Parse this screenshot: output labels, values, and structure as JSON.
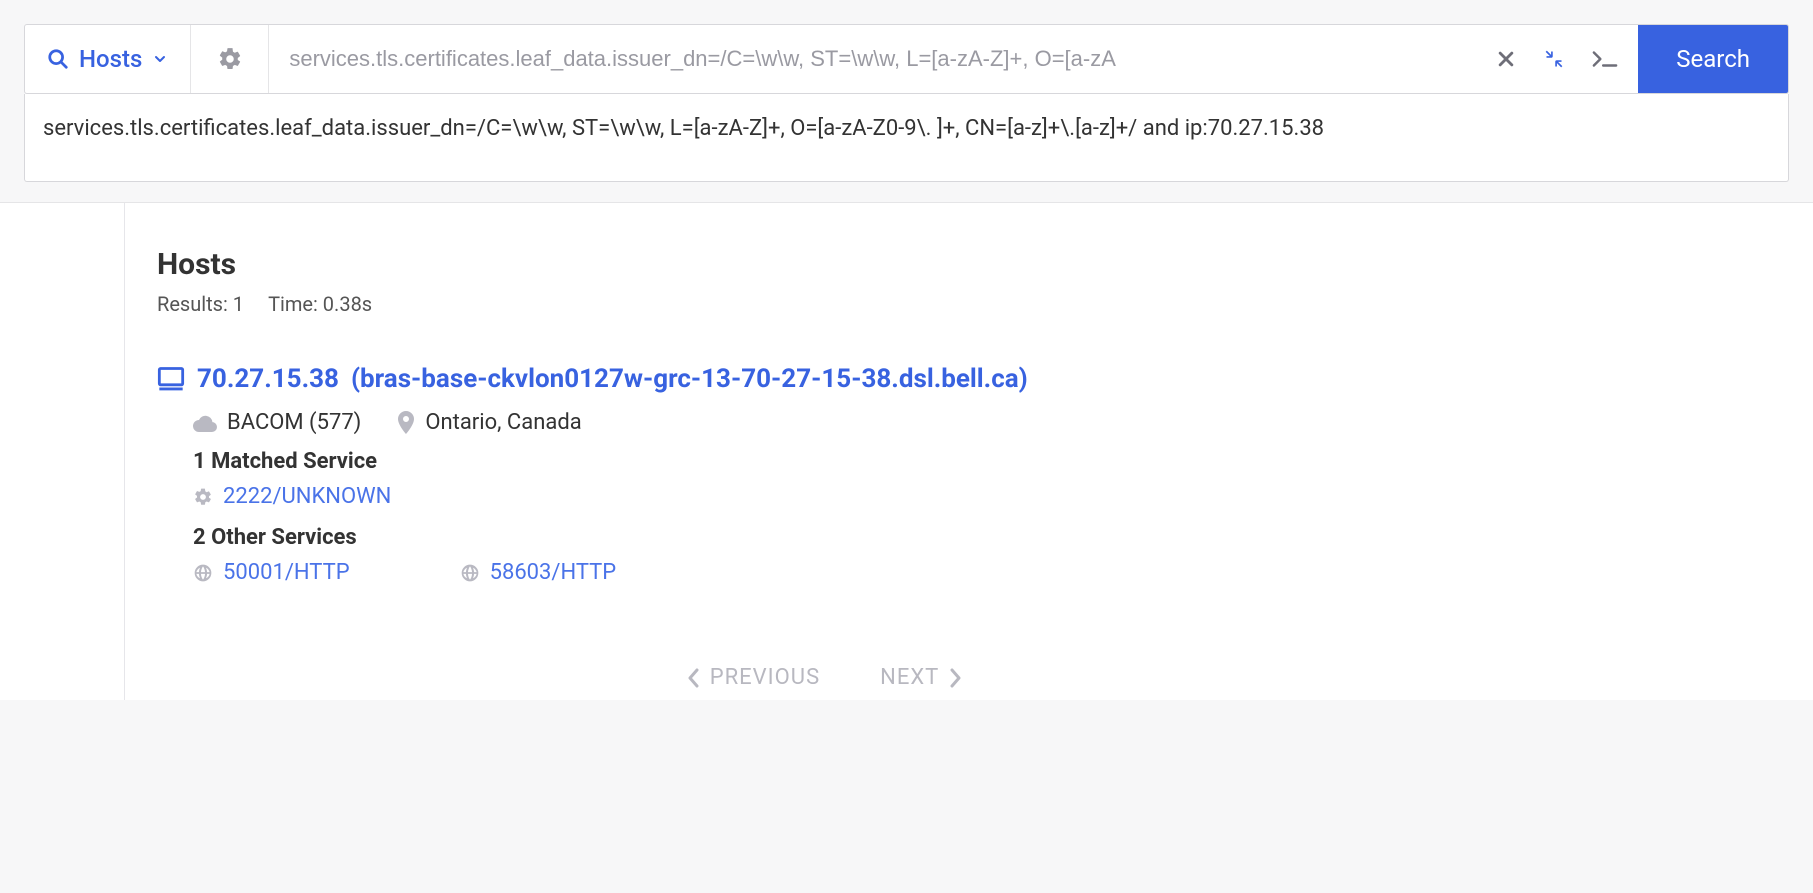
{
  "searchbar": {
    "mode_label": "Hosts",
    "query_placeholder": "services.tls.certificates.leaf_data.issuer_dn=/C=\\w\\w, ST=\\w\\w, L=[a-zA-Z]+, O=[a-zA",
    "search_button_label": "Search",
    "full_query": "services.tls.certificates.leaf_data.issuer_dn=/C=\\w\\w, ST=\\w\\w, L=[a-zA-Z]+, O=[a-zA-Z0-9\\. ]+, CN=[a-z]+\\.[a-z]+/ and ip:70.27.15.38"
  },
  "results": {
    "title": "Hosts",
    "results_label": "Results: 1",
    "time_label": "Time: 0.38s"
  },
  "host": {
    "ip": "70.27.15.38",
    "hostname_wrapped": "(bras-base-ckvlon0127w-grc-13-70-27-15-38.dsl.bell.ca)",
    "as_label": "BACOM (577)",
    "location": "Ontario, Canada",
    "matched_head": "1 Matched Service",
    "matched_services": [
      {
        "label": "2222/UNKNOWN"
      }
    ],
    "other_head": "2 Other Services",
    "other_services": [
      {
        "label": "50001/HTTP"
      },
      {
        "label": "58603/HTTP"
      }
    ]
  },
  "pagination": {
    "prev": "PREVIOUS",
    "next": "NEXT"
  }
}
